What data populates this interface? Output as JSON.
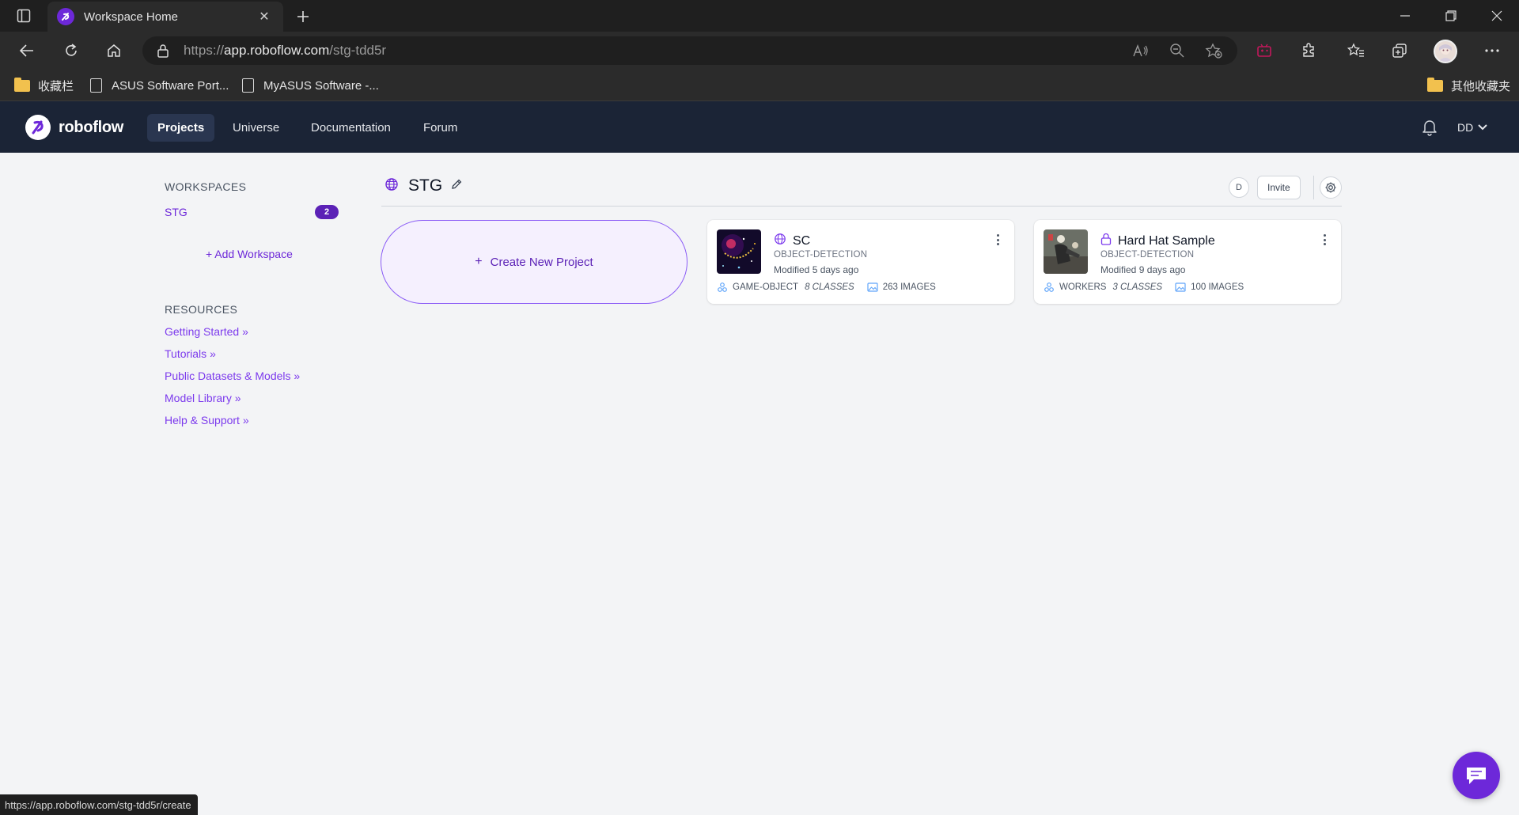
{
  "browser": {
    "tab_title": "Workspace Home",
    "url_scheme": "https://",
    "url_host": "app.roboflow.com",
    "url_path": "/stg-tdd5r",
    "bookmarks": [
      {
        "label": "收藏栏",
        "icon": "folder-icon"
      },
      {
        "label": "ASUS Software Port...",
        "icon": "page-icon"
      },
      {
        "label": "MyASUS Software -...",
        "icon": "page-icon"
      }
    ],
    "other_bookmarks": "其他收藏夹",
    "status_url": "https://app.roboflow.com/stg-tdd5r/create"
  },
  "nav": {
    "brand": "roboflow",
    "links": [
      "Projects",
      "Universe",
      "Documentation",
      "Forum"
    ],
    "active": "Projects",
    "user_initials": "DD"
  },
  "sidebar": {
    "workspaces_heading": "WORKSPACES",
    "workspace": {
      "name": "STG",
      "count": "2"
    },
    "add_workspace": "+ Add Workspace",
    "resources_heading": "RESOURCES",
    "resources": [
      "Getting Started",
      "Tutorials",
      "Public Datasets & Models",
      "Model Library",
      "Help & Support"
    ]
  },
  "workspace": {
    "title": "STG",
    "member_initial": "D",
    "invite_label": "Invite"
  },
  "create_project": {
    "plus": "+",
    "label": "Create New Project"
  },
  "projects": [
    {
      "name": "SC",
      "visibility_icon": "globe-icon",
      "type": "OBJECT-DETECTION",
      "modified": "Modified 5 days ago",
      "class_label": "GAME-OBJECT",
      "classes": "8 CLASSES",
      "images": "263 IMAGES"
    },
    {
      "name": "Hard Hat Sample",
      "visibility_icon": "lock-icon",
      "type": "OBJECT-DETECTION",
      "modified": "Modified 9 days ago",
      "class_label": "WORKERS",
      "classes": "3 CLASSES",
      "images": "100 IMAGES"
    }
  ],
  "colors": {
    "brand_purple": "#6d28d9",
    "nav_bg": "#1b2436",
    "page_bg": "#f3f4f6"
  }
}
